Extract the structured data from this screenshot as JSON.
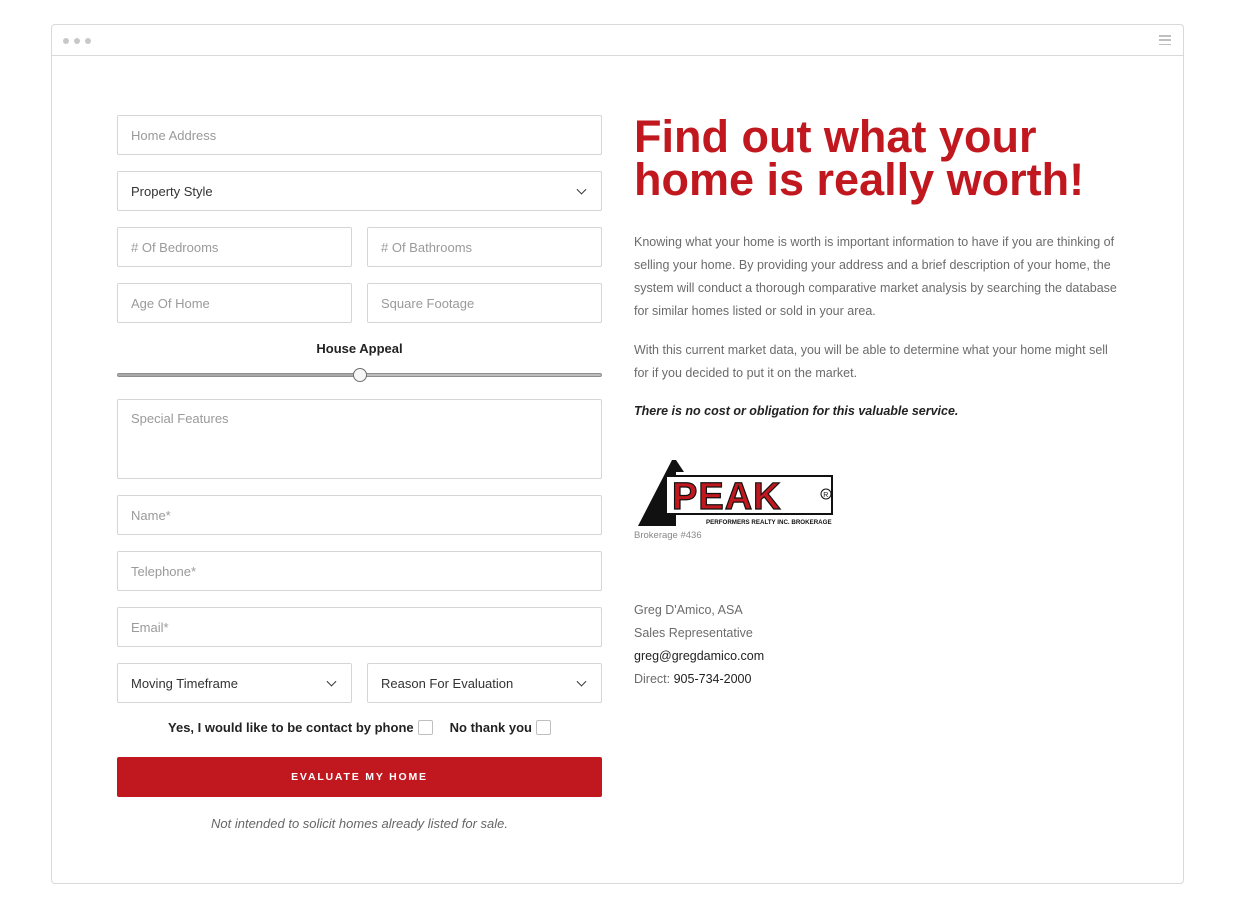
{
  "form": {
    "home_address_placeholder": "Home Address",
    "property_style": "Property Style",
    "bedrooms_placeholder": "# Of Bedrooms",
    "bathrooms_placeholder": "# Of Bathrooms",
    "age_placeholder": "Age Of Home",
    "sqft_placeholder": "Square Footage",
    "house_appeal_label": "House Appeal",
    "house_appeal_value": 0.5,
    "special_features_placeholder": "Special Features",
    "name_placeholder": "Name*",
    "telephone_placeholder": "Telephone*",
    "email_placeholder": "Email*",
    "moving_timeframe": "Moving Timeframe",
    "reason": "Reason For Evaluation",
    "contact_yes": "Yes, I would like to be contact by phone",
    "contact_no": "No thank you",
    "submit_label": "EVALUATE MY HOME",
    "disclaimer": "Not intended to solicit homes already listed for sale."
  },
  "info": {
    "headline": "Find out what your home is really worth!",
    "para1": "Knowing what your home is worth is important information to have if you are thinking of selling your home. By providing your address and a brief description of your home, the system will conduct a thorough comparative market analysis by searching the database for similar homes listed or sold in your area.",
    "para2": "With this current market data, you will be able to determine what your home might sell for if you decided to put it on the market.",
    "para3": "There is no cost or obligation for this valuable service.",
    "brokerage": "Brokerage #436",
    "logo_text": "PEAK",
    "logo_subtext": "PERFORMERS REALTY INC. BROKERAGE",
    "agent_name": "Greg D'Amico, ASA",
    "agent_title": "Sales Representative",
    "agent_email": "greg@gregdamico.com",
    "direct_label": "Direct:",
    "direct_phone": "905-734-2000"
  },
  "colors": {
    "brand_red": "#c1181f"
  }
}
